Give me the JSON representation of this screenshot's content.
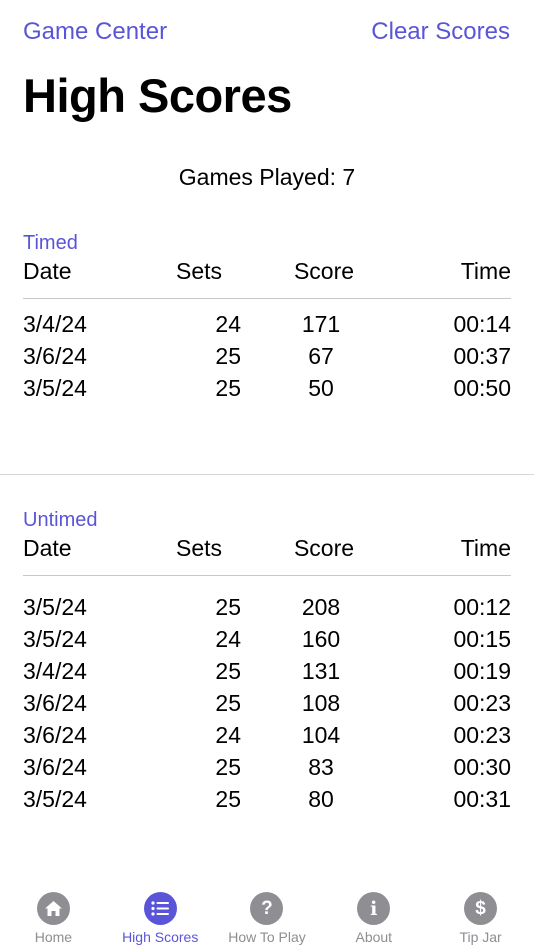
{
  "nav": {
    "game_center": "Game Center",
    "clear_scores": "Clear Scores"
  },
  "title": "High Scores",
  "games_played": "Games Played: 7",
  "columns": {
    "date": "Date",
    "sets": "Sets",
    "score": "Score",
    "time": "Time"
  },
  "timed": {
    "label": "Timed",
    "rows": [
      {
        "date": "3/4/24",
        "sets": "24",
        "score": "171",
        "time": "00:14"
      },
      {
        "date": "3/6/24",
        "sets": "25",
        "score": "67",
        "time": "00:37"
      },
      {
        "date": "3/5/24",
        "sets": "25",
        "score": "50",
        "time": "00:50"
      }
    ]
  },
  "untimed": {
    "label": "Untimed",
    "rows": [
      {
        "date": "3/5/24",
        "sets": "25",
        "score": "208",
        "time": "00:12"
      },
      {
        "date": "3/5/24",
        "sets": "24",
        "score": "160",
        "time": "00:15"
      },
      {
        "date": "3/4/24",
        "sets": "25",
        "score": "131",
        "time": "00:19"
      },
      {
        "date": "3/6/24",
        "sets": "25",
        "score": "108",
        "time": "00:23"
      },
      {
        "date": "3/6/24",
        "sets": "24",
        "score": "104",
        "time": "00:23"
      },
      {
        "date": "3/6/24",
        "sets": "25",
        "score": "83",
        "time": "00:30"
      },
      {
        "date": "3/5/24",
        "sets": "25",
        "score": "80",
        "time": "00:31"
      }
    ]
  },
  "tabs": [
    {
      "label": "Home",
      "icon": "home-icon",
      "active": false
    },
    {
      "label": "High Scores",
      "icon": "list-icon",
      "active": true
    },
    {
      "label": "How To Play",
      "icon": "question-icon",
      "active": false
    },
    {
      "label": "About",
      "icon": "info-icon",
      "active": false
    },
    {
      "label": "Tip Jar",
      "icon": "dollar-icon",
      "active": false
    }
  ],
  "colors": {
    "accent": "#5a55d8",
    "inactive": "#8e8e93",
    "divider": "#c8c8cc"
  }
}
